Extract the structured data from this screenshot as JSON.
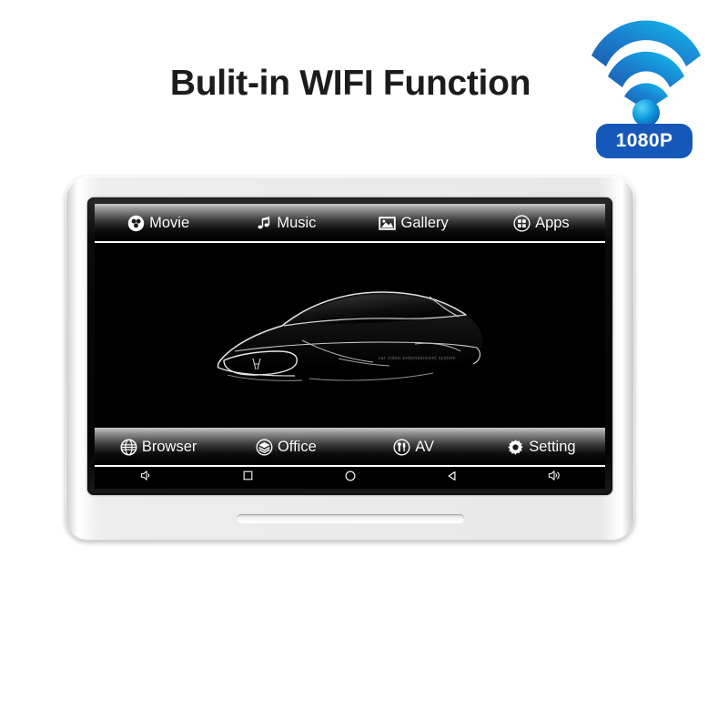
{
  "headline": "Bulit-in WIFI Function",
  "wifi": {
    "icon": "wifi-signal-icon",
    "badge_label": "1080P",
    "badge_color": "#1558ba",
    "arc_color_outer": "#1b6fc4",
    "arc_color_inner": "#0fb6e8"
  },
  "device": {
    "bezel_color": "#e8e8e8",
    "screen_color": "#000000",
    "speaker_slot": "speaker-grille-slot"
  },
  "screen": {
    "top_menu": [
      {
        "label": "Movie",
        "icon": "film-reel-icon"
      },
      {
        "label": "Music",
        "icon": "music-note-icon"
      },
      {
        "label": "Gallery",
        "icon": "picture-icon"
      },
      {
        "label": "Apps",
        "icon": "apps-grid-icon"
      }
    ],
    "bottom_menu": [
      {
        "label": "Browser",
        "icon": "globe-icon"
      },
      {
        "label": "Office",
        "icon": "layers-icon"
      },
      {
        "label": "AV",
        "icon": "av-plug-icon"
      },
      {
        "label": "Setting",
        "icon": "gear-icon"
      }
    ],
    "wallpaper": {
      "image": "sports-car-line-art",
      "caption": "car video entertainment system"
    },
    "navbar": [
      {
        "icon": "volume-down-icon",
        "name": "volume-down-button"
      },
      {
        "icon": "square-icon",
        "name": "recent-apps-button"
      },
      {
        "icon": "circle-icon",
        "name": "home-button"
      },
      {
        "icon": "triangle-left-icon",
        "name": "back-button"
      },
      {
        "icon": "volume-up-icon",
        "name": "volume-up-button"
      }
    ]
  }
}
